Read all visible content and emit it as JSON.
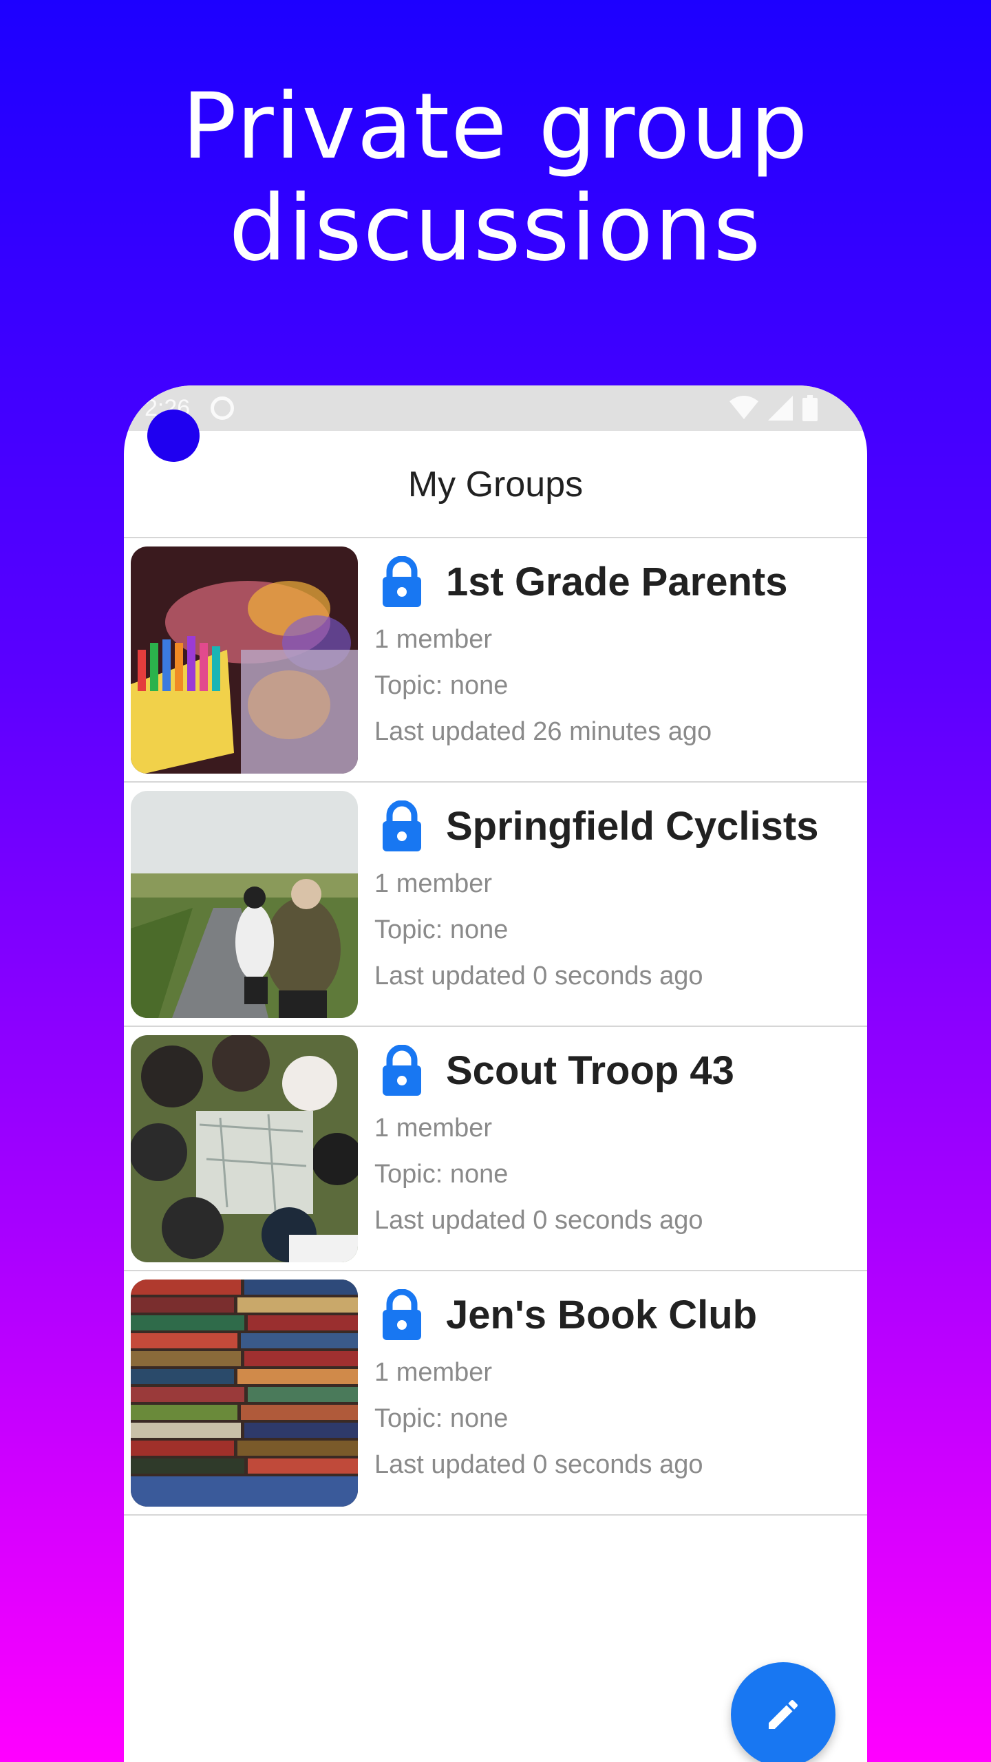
{
  "headline": {
    "line1": "Private group",
    "line2": "discussions"
  },
  "status_bar": {
    "time": "2:26",
    "icons": [
      "notification-icon",
      "wifi-icon",
      "cell-signal-icon",
      "battery-icon"
    ]
  },
  "app_bar": {
    "title": "My Groups"
  },
  "groups": [
    {
      "name": "1st Grade Parents",
      "members": "1 member",
      "topic": "Topic: none",
      "updated": "Last updated 26 minutes ago",
      "image": "crayons-photo"
    },
    {
      "name": "Springfield Cyclists",
      "members": "1 member",
      "topic": "Topic: none",
      "updated": "Last updated 0 seconds ago",
      "image": "cyclists-photo"
    },
    {
      "name": "Scout Troop 43",
      "members": "1 member",
      "topic": "Topic: none",
      "updated": "Last updated 0 seconds ago",
      "image": "scouts-map-photo"
    },
    {
      "name": "Jen's Book Club",
      "members": "1 member",
      "topic": "Topic: none",
      "updated": "Last updated 0 seconds ago",
      "image": "books-photo"
    }
  ],
  "fab": {
    "icon": "pencil-icon"
  },
  "colors": {
    "accent": "#1877f2",
    "avatar": "#1f00f0",
    "background_top": "#1d00ff",
    "background_bottom": "#ff00ff"
  }
}
